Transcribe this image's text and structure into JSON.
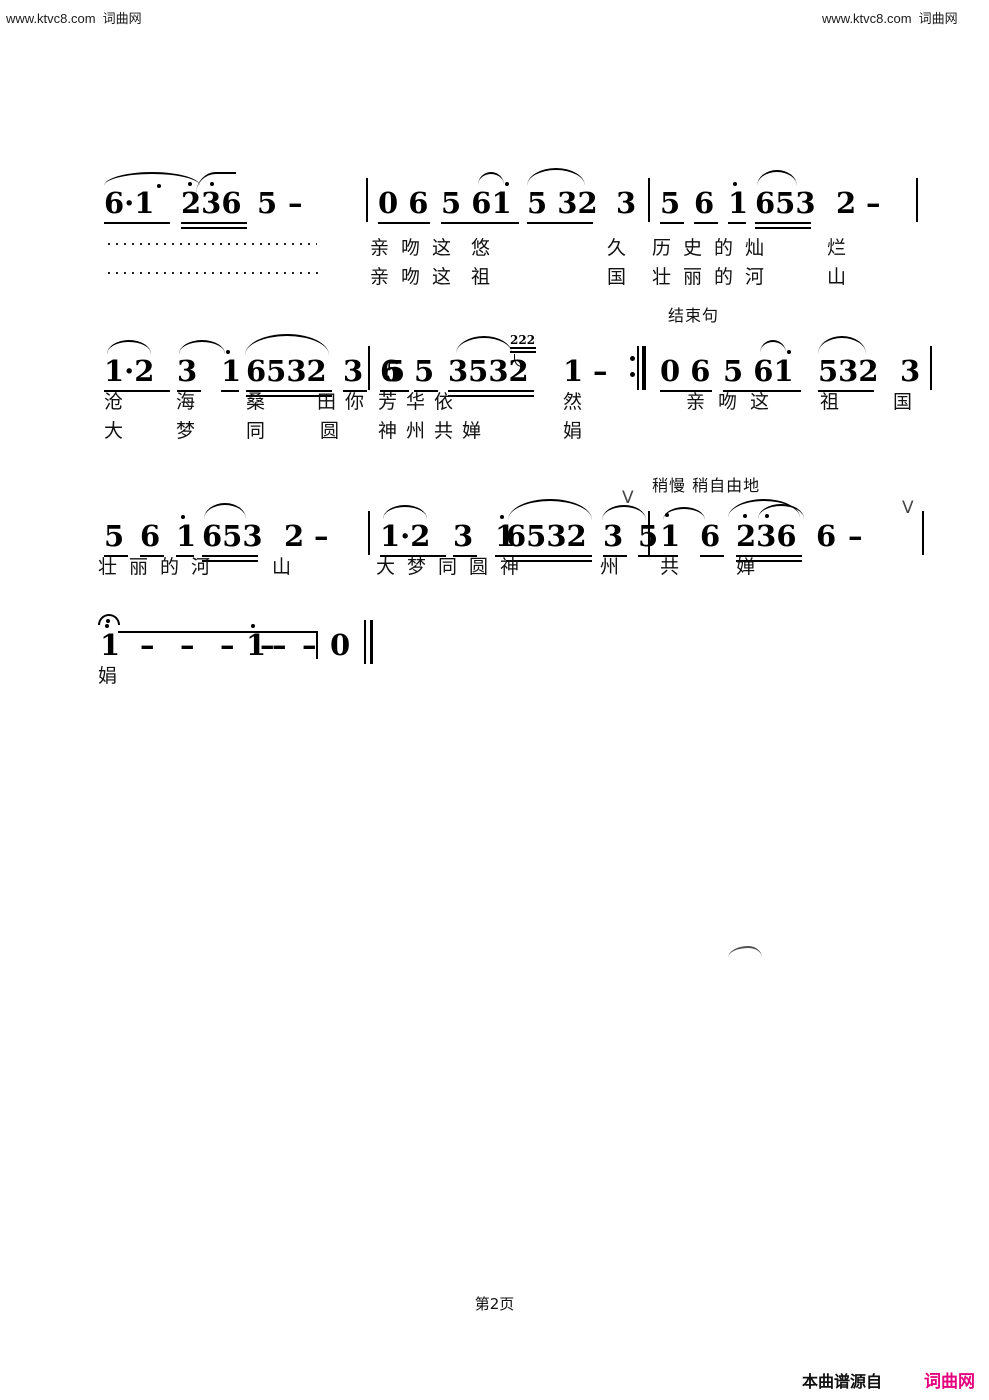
{
  "watermarks": {
    "left": {
      "url": "www.ktvc8.com",
      "site": "词曲网"
    },
    "right": {
      "url": "www.ktvc8.com",
      "site": "词曲网"
    }
  },
  "footer": {
    "page_label": "第2页",
    "source_prefix": "本曲谱源自",
    "source_site": "词曲网",
    "source_site_color": "#e6007e"
  },
  "score": {
    "notation": "jianpu",
    "systems": [
      {
        "id": "system-1",
        "measures": [
          {
            "notes": "6·1 236 5 –",
            "lyrics_line1": "",
            "lyrics_line2": ""
          },
          {
            "notes": "0 6 5 61 5 32 3",
            "lyrics_line1": "亲 吻 这 悠 久 历",
            "lyrics_line2": "亲 吻 这 祖 国 壮"
          },
          {
            "notes": "5 6 1 653 2 –",
            "lyrics_line1": "史 的 灿 烂",
            "lyrics_line2": "丽 的 河 山"
          }
        ],
        "note_tokens": [
          "6",
          "·",
          "1",
          "2",
          "3",
          "6",
          "5",
          "–",
          "0",
          "6",
          "5",
          "6",
          "1",
          "5",
          "3",
          "2",
          "3",
          "5",
          "6",
          "1",
          "6",
          "5",
          "3",
          "2",
          "–"
        ],
        "lyrics_row1": [
          "亲",
          "吻",
          "这",
          "悠",
          "久",
          "历",
          "史",
          "的",
          "灿",
          "烂"
        ],
        "lyrics_row2": [
          "亲",
          "吻",
          "这",
          "祖",
          "国",
          "壮",
          "丽",
          "的",
          "河",
          "山"
        ],
        "placeholder_dots": true
      },
      {
        "id": "system-2",
        "marks": [
          {
            "text": "结束句",
            "kind": "section-label"
          }
        ],
        "note_tokens": [
          "1",
          "·",
          "2",
          "3",
          "1",
          "6",
          "5",
          "3",
          "2",
          "3",
          "5",
          "6",
          "5",
          "3",
          "5",
          "3",
          "2",
          "1",
          "–",
          "0",
          "6",
          "5",
          "6",
          "1",
          "5",
          "3",
          "2",
          "3"
        ],
        "grace_notes": "222",
        "lyrics_row1": [
          "沧",
          "海",
          "桑",
          "田",
          "你",
          "芳",
          "华",
          "依",
          "然",
          "亲",
          "吻",
          "这",
          "祖",
          "国"
        ],
        "lyrics_row2": [
          "大",
          "梦",
          "同",
          "圆",
          "神",
          "州",
          "共",
          "婵",
          "娟"
        ],
        "repeat_sign": true
      },
      {
        "id": "system-3",
        "marks": [
          {
            "text": "稍慢 稍自由地",
            "kind": "tempo"
          }
        ],
        "note_tokens": [
          "5",
          "6",
          "1",
          "6",
          "5",
          "3",
          "2",
          "–",
          "1",
          "·",
          "2",
          "3",
          "1",
          "6",
          "5",
          "3",
          "2",
          "3",
          "5",
          "1",
          "6",
          "2",
          "3",
          "6",
          "6",
          "–"
        ],
        "lyrics_row1": [
          "壮",
          "丽",
          "的",
          "河",
          "山",
          "大",
          "梦",
          "同",
          "圆",
          "神",
          "州",
          "共",
          "婵"
        ],
        "breath_marks": [
          "V",
          "V"
        ]
      },
      {
        "id": "system-4",
        "note_tokens": [
          "1",
          "–",
          "–",
          "–",
          "–",
          "1",
          "–",
          "–",
          "0"
        ],
        "lyrics_row1": [
          "娟"
        ],
        "fermata": true,
        "final_double_bar": true
      }
    ]
  }
}
